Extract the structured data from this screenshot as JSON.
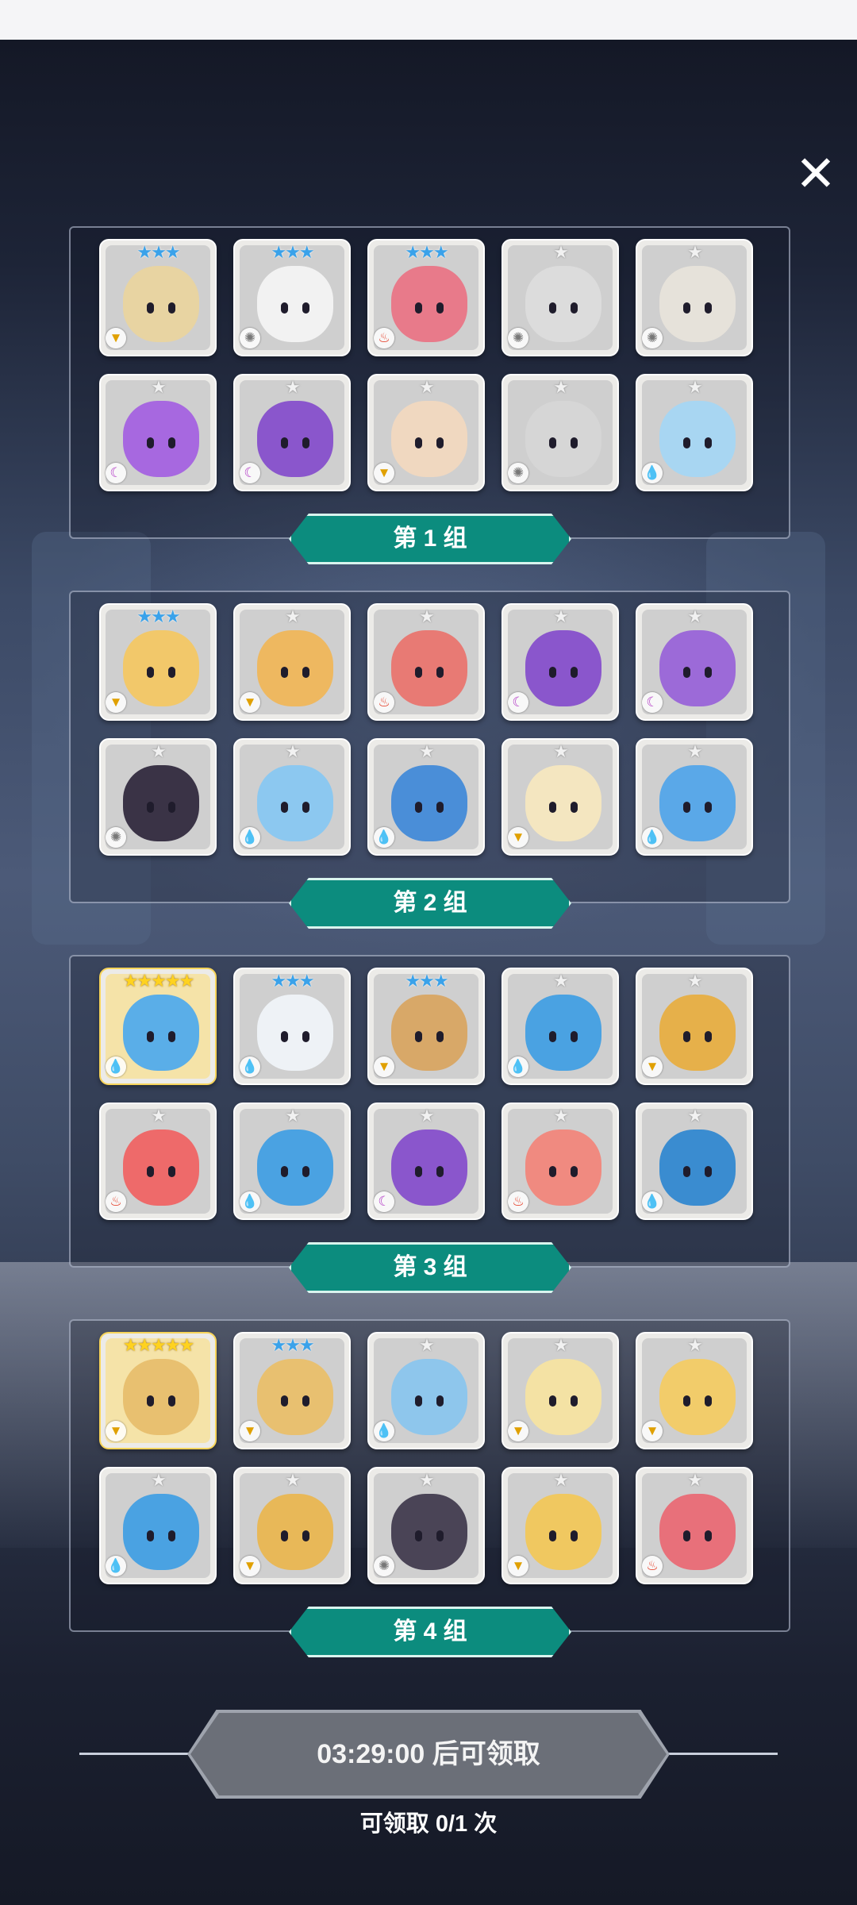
{
  "close_label": "✕",
  "groups": [
    {
      "label": "第 1 组",
      "heroes": [
        {
          "stars": "★★★",
          "star_tier": "blue",
          "element": "earth",
          "color": "#e8d4a2"
        },
        {
          "stars": "★★★",
          "star_tier": "blue",
          "element": "light",
          "color": "#f2f2f2"
        },
        {
          "stars": "★★★",
          "star_tier": "blue",
          "element": "fire",
          "color": "#e87a8a"
        },
        {
          "stars": "★",
          "star_tier": "silver",
          "element": "light",
          "color": "#dcdcdc"
        },
        {
          "stars": "★",
          "star_tier": "silver",
          "element": "light",
          "color": "#e6e2da"
        },
        {
          "stars": "★",
          "star_tier": "silver",
          "element": "dark",
          "color": "#a768e0"
        },
        {
          "stars": "★",
          "star_tier": "silver",
          "element": "dark",
          "color": "#8a56cc"
        },
        {
          "stars": "★",
          "star_tier": "silver",
          "element": "earth",
          "color": "#f0d8c0"
        },
        {
          "stars": "★",
          "star_tier": "silver",
          "element": "light",
          "color": "#d6d6d6"
        },
        {
          "stars": "★",
          "star_tier": "silver",
          "element": "water",
          "color": "#a8d6f2"
        }
      ]
    },
    {
      "label": "第 2 组",
      "heroes": [
        {
          "stars": "★★★",
          "star_tier": "blue",
          "element": "earth",
          "color": "#f2c86a"
        },
        {
          "stars": "★",
          "star_tier": "silver",
          "element": "earth",
          "color": "#eeb860"
        },
        {
          "stars": "★",
          "star_tier": "silver",
          "element": "fire",
          "color": "#e87a74"
        },
        {
          "stars": "★",
          "star_tier": "silver",
          "element": "dark",
          "color": "#8a56cc"
        },
        {
          "stars": "★",
          "star_tier": "silver",
          "element": "dark",
          "color": "#9c6ad8"
        },
        {
          "stars": "★",
          "star_tier": "silver",
          "element": "light",
          "color": "#3a3346"
        },
        {
          "stars": "★",
          "star_tier": "silver",
          "element": "water",
          "color": "#8cc8f0"
        },
        {
          "stars": "★",
          "star_tier": "silver",
          "element": "water",
          "color": "#4a8ed8"
        },
        {
          "stars": "★",
          "star_tier": "silver",
          "element": "earth",
          "color": "#f4e6c0"
        },
        {
          "stars": "★",
          "star_tier": "silver",
          "element": "water",
          "color": "#5aa8e8"
        }
      ]
    },
    {
      "label": "第 3 组",
      "heroes": [
        {
          "stars": "★★★★★",
          "star_tier": "gold",
          "element": "water",
          "color": "#5aaee8",
          "gold": true
        },
        {
          "stars": "★★★",
          "star_tier": "blue",
          "element": "water",
          "color": "#eef2f6"
        },
        {
          "stars": "★★★",
          "star_tier": "blue",
          "element": "earth",
          "color": "#d8a868"
        },
        {
          "stars": "★",
          "star_tier": "silver",
          "element": "water",
          "color": "#4aa2e2"
        },
        {
          "stars": "★",
          "star_tier": "silver",
          "element": "earth",
          "color": "#e6b04a"
        },
        {
          "stars": "★",
          "star_tier": "silver",
          "element": "fire",
          "color": "#ee6a6a"
        },
        {
          "stars": "★",
          "star_tier": "silver",
          "element": "water",
          "color": "#4aa2e2"
        },
        {
          "stars": "★",
          "star_tier": "silver",
          "element": "dark",
          "color": "#8a56cc"
        },
        {
          "stars": "★",
          "star_tier": "silver",
          "element": "fire",
          "color": "#f08a80"
        },
        {
          "stars": "★",
          "star_tier": "silver",
          "element": "water",
          "color": "#3a8cd0"
        }
      ]
    },
    {
      "label": "第 4 组",
      "heroes": [
        {
          "stars": "★★★★★",
          "star_tier": "gold",
          "element": "earth",
          "color": "#e8c070",
          "gold": true
        },
        {
          "stars": "★★★",
          "star_tier": "blue",
          "element": "earth",
          "color": "#e8c070"
        },
        {
          "stars": "★",
          "star_tier": "silver",
          "element": "water",
          "color": "#8ec6ec"
        },
        {
          "stars": "★",
          "star_tier": "silver",
          "element": "earth",
          "color": "#f4e2a4"
        },
        {
          "stars": "★",
          "star_tier": "silver",
          "element": "earth",
          "color": "#f2cc6a"
        },
        {
          "stars": "★",
          "star_tier": "silver",
          "element": "water",
          "color": "#4aa2e2"
        },
        {
          "stars": "★",
          "star_tier": "silver",
          "element": "earth",
          "color": "#e8b858"
        },
        {
          "stars": "★",
          "star_tier": "silver",
          "element": "light",
          "color": "#4a4456"
        },
        {
          "stars": "★",
          "star_tier": "silver",
          "element": "earth",
          "color": "#f0c860"
        },
        {
          "stars": "★",
          "star_tier": "silver",
          "element": "fire",
          "color": "#e8707a"
        }
      ]
    }
  ],
  "claim_button_label": "03:29:00 后可领取",
  "claim_count_text": "可领取 0/1 次",
  "colors": {
    "banner_teal": "#0c8c7e",
    "claim_button_gray": "#6b6f78"
  }
}
